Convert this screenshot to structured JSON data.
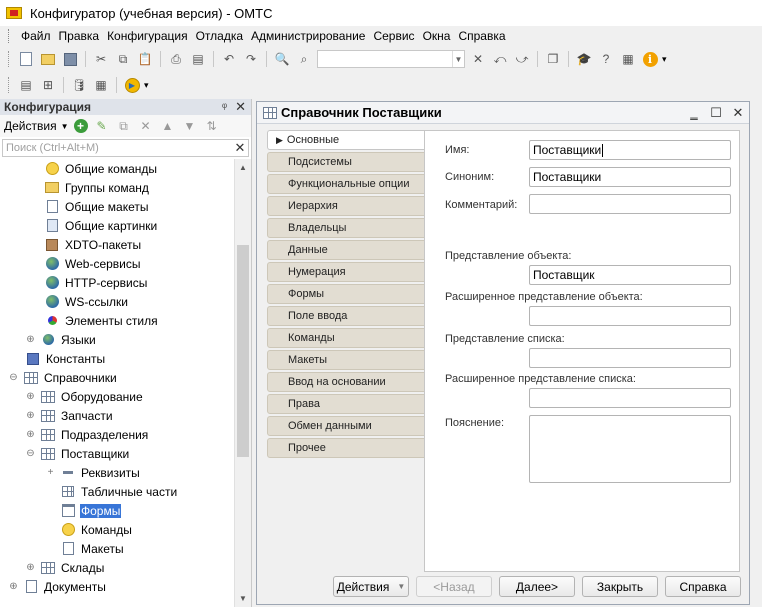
{
  "window": {
    "title": "Конфигуратор (учебная версия) - ОМТС"
  },
  "menu": [
    "Файл",
    "Правка",
    "Конфигурация",
    "Отладка",
    "Администрирование",
    "Сервис",
    "Окна",
    "Справка"
  ],
  "left_panel": {
    "title": "Конфигурация",
    "actions_label": "Действия",
    "search_placeholder": "Поиск (Ctrl+Alt+M)",
    "tree": [
      {
        "label": "Общие команды",
        "icon": "command-icon",
        "level": 2
      },
      {
        "label": "Группы команд",
        "icon": "folder-icon",
        "level": 2
      },
      {
        "label": "Общие макеты",
        "icon": "layout-icon",
        "level": 2
      },
      {
        "label": "Общие картинки",
        "icon": "picture-icon",
        "level": 2
      },
      {
        "label": "XDTO-пакеты",
        "icon": "package-icon",
        "level": 2
      },
      {
        "label": "Web-сервисы",
        "icon": "globe-icon",
        "level": 2
      },
      {
        "label": "HTTP-сервисы",
        "icon": "globe-icon",
        "level": 2
      },
      {
        "label": "WS-ссылки",
        "icon": "globe-icon",
        "level": 2
      },
      {
        "label": "Элементы стиля",
        "icon": "style-icon",
        "level": 2
      },
      {
        "label": "Языки",
        "icon": "language-icon",
        "level": 1,
        "expander": "+"
      },
      {
        "label": "Константы",
        "icon": "constants-icon",
        "level": 0
      },
      {
        "label": "Справочники",
        "icon": "catalog-icon",
        "level": 0,
        "expander": "−"
      },
      {
        "label": "Оборудование",
        "icon": "catalog-icon",
        "level": 1,
        "expander": "+"
      },
      {
        "label": "Запчасти",
        "icon": "catalog-icon",
        "level": 1,
        "expander": "+"
      },
      {
        "label": "Подразделения",
        "icon": "catalog-icon",
        "level": 1,
        "expander": "+"
      },
      {
        "label": "Поставщики",
        "icon": "catalog-icon",
        "level": 1,
        "expander": "−"
      },
      {
        "label": "Реквизиты",
        "icon": "attribute-icon",
        "level": 2,
        "expander": "+"
      },
      {
        "label": "Табличные части",
        "icon": "table-icon",
        "level": 3
      },
      {
        "label": "Формы",
        "icon": "form-icon",
        "level": 3,
        "selected": true
      },
      {
        "label": "Команды",
        "icon": "command-icon",
        "level": 3
      },
      {
        "label": "Макеты",
        "icon": "layout-icon",
        "level": 3
      },
      {
        "label": "Склады",
        "icon": "catalog-icon",
        "level": 1,
        "expander": "+"
      },
      {
        "label": "Документы",
        "icon": "document-icon",
        "level": 0,
        "expander": "+"
      }
    ]
  },
  "dialog": {
    "title": "Справочник Поставщики",
    "tabs": [
      "Основные",
      "Подсистемы",
      "Функциональные опции",
      "Иерархия",
      "Владельцы",
      "Данные",
      "Нумерация",
      "Формы",
      "Поле ввода",
      "Команды",
      "Макеты",
      "Ввод на основании",
      "Права",
      "Обмен данными",
      "Прочее"
    ],
    "active_tab": "Основные",
    "fields": {
      "name_label": "Имя:",
      "name_value": "Поставщики",
      "synonym_label": "Синоним:",
      "synonym_value": "Поставщики",
      "comment_label": "Комментарий:",
      "comment_value": "",
      "object_repr_label": "Представление объекта:",
      "object_repr_value": "Поставщик",
      "ext_object_repr_label": "Расширенное представление объекта:",
      "ext_object_repr_value": "",
      "list_repr_label": "Представление списка:",
      "list_repr_value": "",
      "ext_list_repr_label": "Расширенное представление списка:",
      "ext_list_repr_value": "",
      "explanation_label": "Пояснение:",
      "explanation_value": ""
    },
    "buttons": {
      "actions": "Действия",
      "back": "<Назад",
      "next": "Далее>",
      "close": "Закрыть",
      "help": "Справка"
    }
  }
}
